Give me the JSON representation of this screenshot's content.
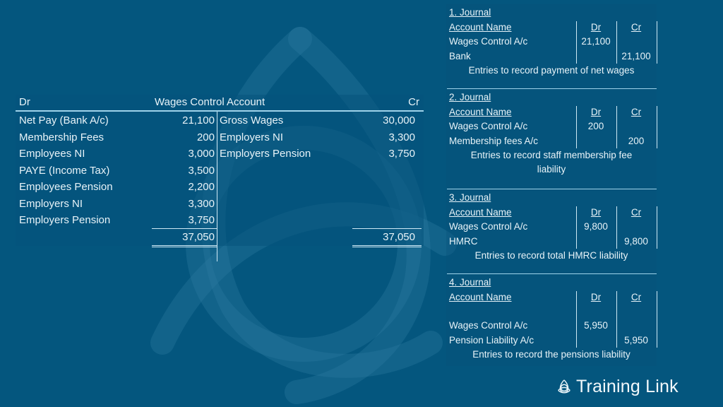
{
  "colors": {
    "background": "#04567e",
    "text": "#e8f3f8",
    "rule": "#9fd3ea"
  },
  "t_account": {
    "dr_label": "Dr",
    "title": "Wages Control Account",
    "cr_label": "Cr",
    "debits": [
      {
        "label": "Net Pay (Bank A/c)",
        "amount": "21,100"
      },
      {
        "label": "Membership Fees",
        "amount": "200"
      },
      {
        "label": "Employees NI",
        "amount": "3,000"
      },
      {
        "label": "PAYE (Income Tax)",
        "amount": "3,500"
      },
      {
        "label": "Employees Pension",
        "amount": "2,200"
      },
      {
        "label": "Employers NI",
        "amount": "3,300"
      },
      {
        "label": "Employers Pension",
        "amount": "3,750"
      }
    ],
    "credits": [
      {
        "label": "Gross Wages",
        "amount": "30,000"
      },
      {
        "label": "Employers NI",
        "amount": "3,300"
      },
      {
        "label": "Employers Pension",
        "amount": "3,750"
      }
    ],
    "dr_total": "37,050",
    "cr_total": "37,050"
  },
  "journals": [
    {
      "title": "1. Journal",
      "head": {
        "account": "Account Name",
        "dr": "Dr",
        "cr": "Cr"
      },
      "lines": [
        {
          "account": "Wages Control A/c",
          "dr": "21,100",
          "cr": ""
        },
        {
          "account": "Bank",
          "dr": "",
          "cr": "21,100"
        }
      ],
      "note": "Entries to record payment of net wages"
    },
    {
      "title": "2. Journal",
      "head": {
        "account": "Account Name",
        "dr": "Dr",
        "cr": "Cr"
      },
      "lines": [
        {
          "account": "Wages Control A/c",
          "dr": "200",
          "cr": ""
        },
        {
          "account": "Membership fees A/c",
          "dr": "",
          "cr": "200"
        }
      ],
      "note": "Entries to record staff membership fee liability"
    },
    {
      "title": "3. Journal",
      "head": {
        "account": "Account Name",
        "dr": "Dr",
        "cr": "Cr"
      },
      "lines": [
        {
          "account": "Wages Control A/c",
          "dr": "9,800",
          "cr": ""
        },
        {
          "account": "HMRC",
          "dr": "",
          "cr": "9,800"
        }
      ],
      "note": "Entries to record total HMRC liability"
    },
    {
      "title": "4. Journal",
      "head": {
        "account": "Account Name",
        "dr": "Dr",
        "cr": "Cr"
      },
      "lines": [
        {
          "account": "Wages Control A/c",
          "dr": "5,950",
          "cr": ""
        },
        {
          "account": "Pension Liability A/c",
          "dr": "",
          "cr": "5,950"
        }
      ],
      "note": "Entries to record the pensions liability"
    }
  ],
  "logo": {
    "text": "Training Link",
    "icon": "triquetra-icon"
  }
}
